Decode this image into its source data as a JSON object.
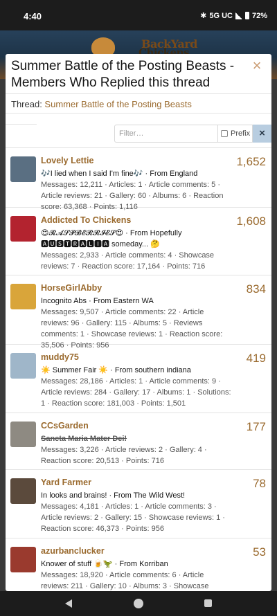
{
  "status": {
    "time": "4:40",
    "network": "5G UC",
    "battery": "72%"
  },
  "site": {
    "logo_line1": "BackYard",
    "logo_line2": "Chickens"
  },
  "dialog": {
    "title": "Summer Battle of the Posting Beasts - Members Who Replied this thread",
    "thread_label": "Thread: ",
    "thread_link": "Summer Battle of the Posting Beasts",
    "close_glyph": "×"
  },
  "filter": {
    "placeholder": "Filter…",
    "prefix_label": "Prefix",
    "clear_glyph": "×"
  },
  "members": [
    {
      "name": "Lovely Lettie",
      "title": "🎶I lied when I said I'm fine🎶 · From England",
      "stats": "Messages: 12,211 · Articles: 1 · Article comments: 5 · Article reviews: 21 · Gallery: 60 · Albums: 6 · Reaction score: 63,368 · Points: 1,116",
      "count": "1,652",
      "avatar_color": "#5a6f82"
    },
    {
      "name": "Addicted To Chickens",
      "title": "😍𝓡𝓐𝓢𝓟𝓑𝓔𝓡𝓡𝓘𝓔𝓢😍 · From Hopefully 🅰🆄🆂🆃🆁🅰🅻🅸🅰 someday... 🤔",
      "stats": "Messages: 2,933 · Article comments: 4 · Showcase reviews: 7 · Reaction score: 17,164 · Points: 716",
      "count": "1,608",
      "avatar_color": "#b3232f"
    },
    {
      "name": "HorseGirlAbby",
      "title": "Incognito Abs · From Eastern WA",
      "stats": "Messages: 9,507 · Article comments: 22 · Article reviews: 96 · Gallery: 115 · Albums: 5 · Reviews comments: 1 · Showcase reviews: 1 · Reaction score: 35,506 · Points: 956",
      "count": "834",
      "avatar_color": "#d9a53a"
    },
    {
      "name": "muddy75",
      "title": "☀️ Summer Fair ☀️ · From southern indiana",
      "stats": "Messages: 28,186 · Articles: 1 · Article comments: 9 · Article reviews: 284 · Gallery: 17 · Albums: 1 · Solutions: 1 · Reaction score: 181,003 · Points: 1,501",
      "count": "419",
      "avatar_color": "#9fb6c9"
    },
    {
      "name": "CCsGarden",
      "title": "Sancta Maria Mater Dei!",
      "stats": "Messages: 3,226 · Article reviews: 2 · Gallery: 4 · Reaction score: 20,513 · Points: 716",
      "count": "177",
      "avatar_color": "#8e8a82"
    },
    {
      "name": "Yard Farmer",
      "title": "In looks and brains! · From The Wild West!",
      "stats": "Messages: 4,181 · Articles: 1 · Article comments: 3 · Article reviews: 2 · Gallery: 15 · Showcase reviews: 1 · Reaction score: 46,373 · Points: 956",
      "count": "78",
      "avatar_color": "#5b4a3c"
    },
    {
      "name": "azurbanclucker",
      "title": "Knower of stuff 🍺🦖 · From Korriban",
      "stats": "Messages: 18,920 · Article comments: 6 · Article reviews: 211 · Gallery: 10 · Albums: 3 · Showcase reviews: 1 · Reaction score:",
      "count": "53",
      "avatar_color": "#9a3a2e"
    }
  ]
}
